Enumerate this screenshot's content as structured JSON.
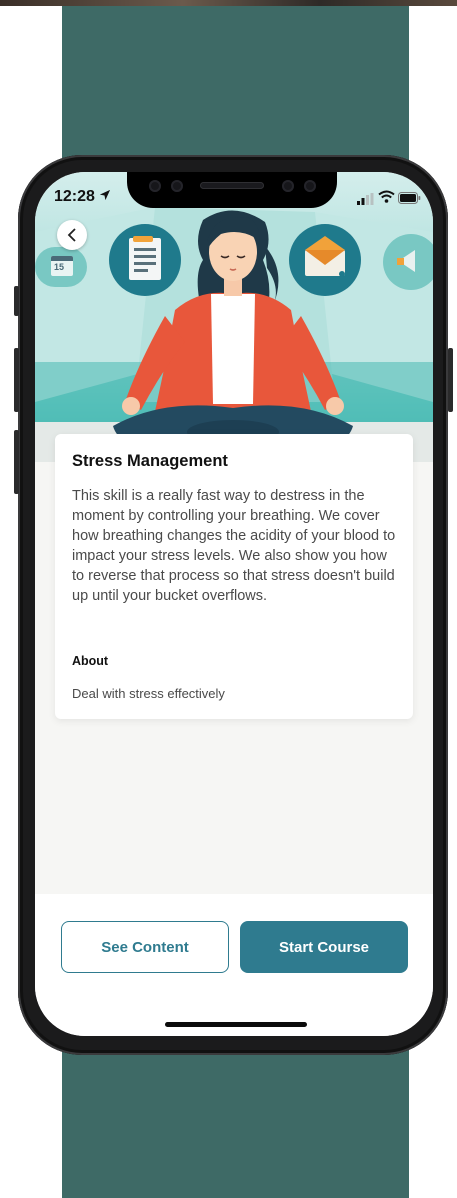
{
  "status_bar": {
    "time": "12:28"
  },
  "hero": {
    "calendar_number": "15"
  },
  "card": {
    "title": "Stress Management",
    "description": "This skill is a really fast way to destress in the moment by controlling your breathing. We cover how breathing changes the acidity of your blood to impact your stress levels. We also show you how to reverse that process so that stress doesn't build up until your bucket overflows.",
    "about_label": "About",
    "about_text": "Deal with stress effectively"
  },
  "actions": {
    "see_content": "See Content",
    "start_course": "Start Course"
  },
  "colors": {
    "accent": "#2f7b8f",
    "background_band": "#3e6a66",
    "hero_teal": "#43b5ae",
    "shirt": "#e8573b",
    "pants": "#234a60"
  }
}
